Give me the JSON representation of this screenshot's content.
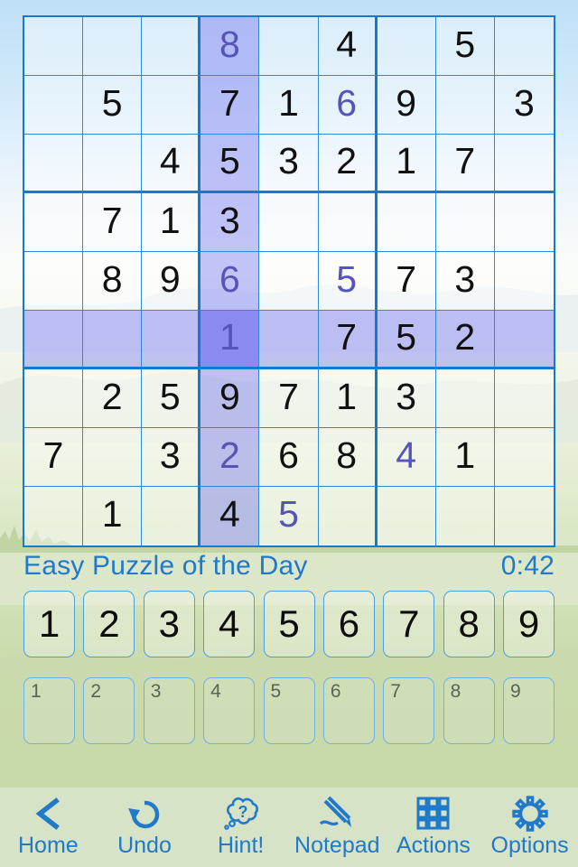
{
  "status": {
    "puzzle_title": "Easy Puzzle of the Day",
    "timer": "0:42",
    "accent_color": "#2079c9"
  },
  "board": {
    "selected_cell": {
      "row": 6,
      "col": 4
    },
    "highlight_col": 4,
    "highlight_row": 6,
    "given_color": "#111111",
    "user_color": "#5654b8",
    "grid_line_color": "#2d8ad8",
    "box_line_color": "#1479d0",
    "selected_bg": "#8a8af0",
    "highlight_bg": "#a0a0f4",
    "rows": [
      [
        {
          "v": "",
          "t": ""
        },
        {
          "v": "",
          "t": ""
        },
        {
          "v": "",
          "t": ""
        },
        {
          "v": "8",
          "t": "user"
        },
        {
          "v": "",
          "t": ""
        },
        {
          "v": "4",
          "t": "given"
        },
        {
          "v": "",
          "t": ""
        },
        {
          "v": "5",
          "t": "given"
        },
        {
          "v": "",
          "t": ""
        }
      ],
      [
        {
          "v": "",
          "t": ""
        },
        {
          "v": "5",
          "t": "given"
        },
        {
          "v": "",
          "t": ""
        },
        {
          "v": "7",
          "t": "given"
        },
        {
          "v": "1",
          "t": "given"
        },
        {
          "v": "6",
          "t": "user"
        },
        {
          "v": "9",
          "t": "given"
        },
        {
          "v": "",
          "t": ""
        },
        {
          "v": "3",
          "t": "given"
        }
      ],
      [
        {
          "v": "",
          "t": ""
        },
        {
          "v": "",
          "t": ""
        },
        {
          "v": "4",
          "t": "given"
        },
        {
          "v": "5",
          "t": "given"
        },
        {
          "v": "3",
          "t": "given"
        },
        {
          "v": "2",
          "t": "given"
        },
        {
          "v": "1",
          "t": "given"
        },
        {
          "v": "7",
          "t": "given"
        },
        {
          "v": "",
          "t": ""
        }
      ],
      [
        {
          "v": "",
          "t": ""
        },
        {
          "v": "7",
          "t": "given"
        },
        {
          "v": "1",
          "t": "given"
        },
        {
          "v": "3",
          "t": "given"
        },
        {
          "v": "",
          "t": ""
        },
        {
          "v": "",
          "t": ""
        },
        {
          "v": "",
          "t": ""
        },
        {
          "v": "",
          "t": ""
        },
        {
          "v": "",
          "t": ""
        }
      ],
      [
        {
          "v": "",
          "t": ""
        },
        {
          "v": "8",
          "t": "given"
        },
        {
          "v": "9",
          "t": "given"
        },
        {
          "v": "6",
          "t": "user"
        },
        {
          "v": "",
          "t": ""
        },
        {
          "v": "5",
          "t": "user"
        },
        {
          "v": "7",
          "t": "given"
        },
        {
          "v": "3",
          "t": "given"
        },
        {
          "v": "",
          "t": ""
        }
      ],
      [
        {
          "v": "",
          "t": ""
        },
        {
          "v": "",
          "t": ""
        },
        {
          "v": "",
          "t": ""
        },
        {
          "v": "1",
          "t": "user"
        },
        {
          "v": "",
          "t": ""
        },
        {
          "v": "7",
          "t": "given"
        },
        {
          "v": "5",
          "t": "given"
        },
        {
          "v": "2",
          "t": "given"
        },
        {
          "v": "",
          "t": ""
        }
      ],
      [
        {
          "v": "",
          "t": ""
        },
        {
          "v": "2",
          "t": "given"
        },
        {
          "v": "5",
          "t": "given"
        },
        {
          "v": "9",
          "t": "given"
        },
        {
          "v": "7",
          "t": "given"
        },
        {
          "v": "1",
          "t": "given"
        },
        {
          "v": "3",
          "t": "given"
        },
        {
          "v": "",
          "t": ""
        },
        {
          "v": "",
          "t": ""
        }
      ],
      [
        {
          "v": "7",
          "t": "given"
        },
        {
          "v": "",
          "t": ""
        },
        {
          "v": "3",
          "t": "given"
        },
        {
          "v": "2",
          "t": "user"
        },
        {
          "v": "6",
          "t": "given"
        },
        {
          "v": "8",
          "t": "given"
        },
        {
          "v": "4",
          "t": "user"
        },
        {
          "v": "1",
          "t": "given"
        },
        {
          "v": "",
          "t": ""
        }
      ],
      [
        {
          "v": "",
          "t": ""
        },
        {
          "v": "1",
          "t": "given"
        },
        {
          "v": "",
          "t": ""
        },
        {
          "v": "4",
          "t": "given"
        },
        {
          "v": "5",
          "t": "user"
        },
        {
          "v": "",
          "t": ""
        },
        {
          "v": "",
          "t": ""
        },
        {
          "v": "",
          "t": ""
        },
        {
          "v": "",
          "t": ""
        }
      ]
    ]
  },
  "number_pad": {
    "main": [
      "1",
      "2",
      "3",
      "4",
      "5",
      "6",
      "7",
      "8",
      "9"
    ],
    "notes": [
      "1",
      "2",
      "3",
      "4",
      "5",
      "6",
      "7",
      "8",
      "9"
    ]
  },
  "toolbar": {
    "items": [
      {
        "label": "Home",
        "icon": "back-chevron-icon"
      },
      {
        "label": "Undo",
        "icon": "undo-arrow-icon"
      },
      {
        "label": "Hint!",
        "icon": "thought-bubble-question-icon"
      },
      {
        "label": "Notepad",
        "icon": "pencil-icon"
      },
      {
        "label": "Actions",
        "icon": "grid-squares-icon"
      },
      {
        "label": "Options",
        "icon": "gear-icon"
      }
    ]
  }
}
